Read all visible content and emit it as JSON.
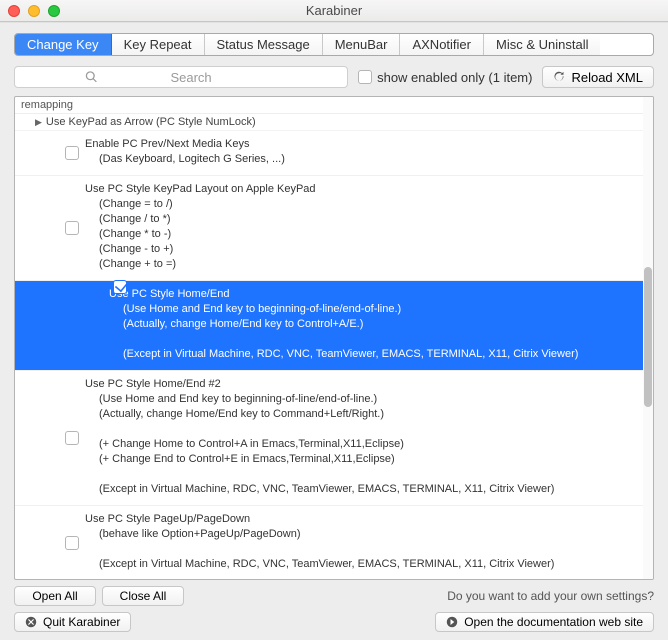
{
  "window": {
    "title": "Karabiner"
  },
  "tabs": [
    {
      "label": "Change Key",
      "active": true
    },
    {
      "label": "Key Repeat"
    },
    {
      "label": "Status Message"
    },
    {
      "label": "MenuBar"
    },
    {
      "label": "AXNotifier"
    },
    {
      "label": "Misc & Uninstall"
    }
  ],
  "search": {
    "placeholder": "Search"
  },
  "show_enabled": {
    "label": "show enabled only (1 item)",
    "checked": false
  },
  "reload_btn": "Reload XML",
  "list": {
    "section": "remapping",
    "top_row": "Use KeyPad as Arrow (PC Style NumLock)",
    "items": [
      {
        "checked": false,
        "title": "Enable PC Prev/Next Media Keys",
        "lines": [
          "(Das Keyboard, Logitech G Series, ...)"
        ]
      },
      {
        "checked": false,
        "title": "Use PC Style KeyPad Layout on Apple KeyPad",
        "lines": [
          "(Change = to /)",
          "(Change / to *)",
          "(Change * to -)",
          "(Change - to +)",
          "(Change + to =)"
        ]
      },
      {
        "checked": true,
        "selected": true,
        "title": "Use PC Style Home/End",
        "lines": [
          "(Use Home and End key to beginning-of-line/end-of-line.)",
          "(Actually, change Home/End key to Control+A/E.)",
          "",
          "(Except in Virtual Machine, RDC, VNC, TeamViewer, EMACS, TERMINAL, X11, Citrix Viewer)"
        ]
      },
      {
        "checked": false,
        "title": "Use PC Style Home/End #2",
        "lines": [
          "(Use Home and End key to beginning-of-line/end-of-line.)",
          "(Actually, change Home/End key to Command+Left/Right.)",
          "",
          "(+ Change Home to Control+A in Emacs,Terminal,X11,Eclipse)",
          "(+ Change End to Control+E in Emacs,Terminal,X11,Eclipse)",
          "",
          "(Except in Virtual Machine, RDC, VNC, TeamViewer, EMACS, TERMINAL, X11, Citrix Viewer)"
        ]
      },
      {
        "checked": false,
        "title": "Use PC Style PageUp/PageDown",
        "lines": [
          "(behave like Option+PageUp/PageDown)",
          "",
          "(Except in Virtual Machine, RDC, VNC, TeamViewer, EMACS, TERMINAL, X11, Citrix Viewer)"
        ]
      }
    ]
  },
  "bottom": {
    "open_all": "Open All",
    "close_all": "Close All",
    "hint": "Do you want to add your own settings?",
    "quit": "Quit Karabiner",
    "docs": "Open the documentation web site"
  }
}
